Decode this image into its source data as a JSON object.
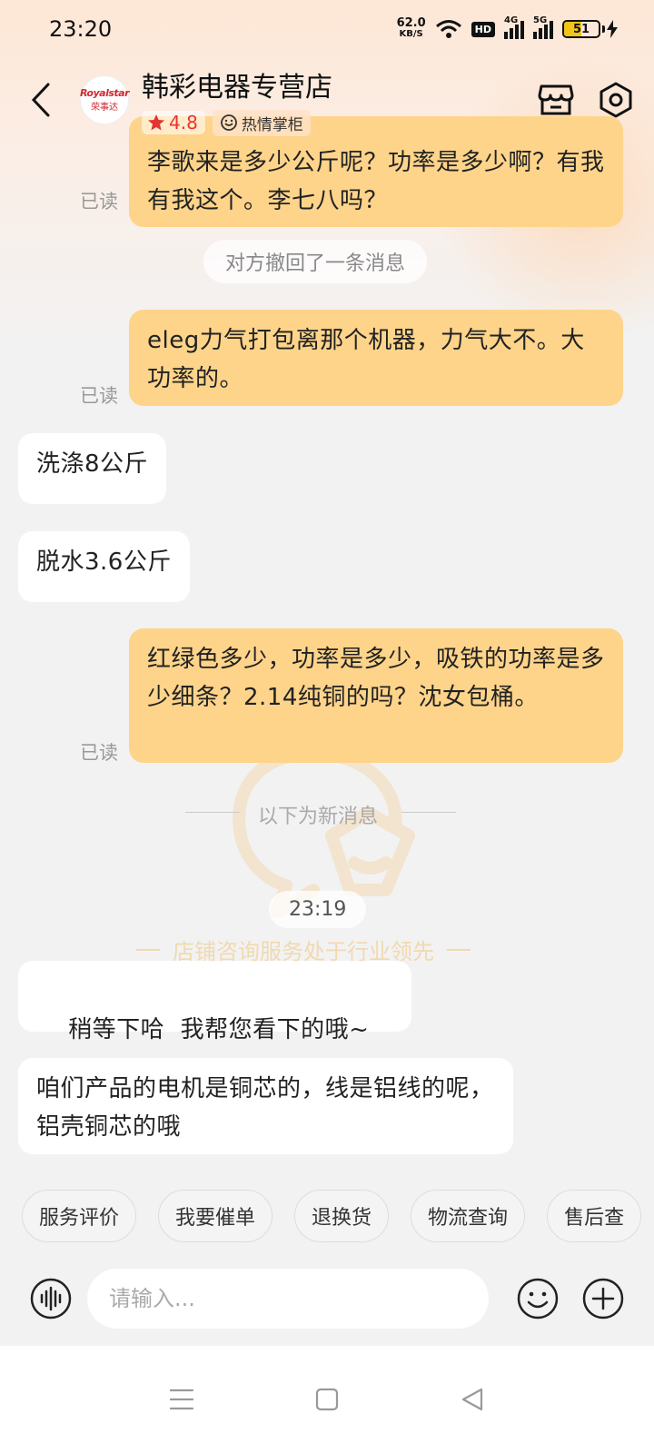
{
  "status_bar": {
    "time": "23:20",
    "net_speed_value": "62.0",
    "net_speed_unit": "KB/S",
    "hd_label": "HD",
    "signal1_label": "4G",
    "signal2_label": "5G",
    "battery_level": "51",
    "battery_fraction": 0.51,
    "battery_color": "#f0c419"
  },
  "header": {
    "back_icon": "chevron-left-icon",
    "avatar_brand": "Royalstar",
    "avatar_brand_cn": "荣事达",
    "shop_name": "韩彩电器专营店",
    "rating": "4.8",
    "badge": "热情掌柜",
    "store_icon": "store-icon",
    "settings_icon": "settings-icon"
  },
  "messages": [
    {
      "side": "me",
      "text": "李歌来是多少公斤呢？功率是多少啊？有我有我这个。李七八吗？",
      "status": "已读"
    },
    {
      "system": "对方撤回了一条消息"
    },
    {
      "side": "me",
      "text": "eleg力气打包离那个机器，力气大不。大功率的。",
      "status": "已读"
    },
    {
      "side": "them",
      "text": "洗涤8公斤"
    },
    {
      "side": "them",
      "text": "脱水3.6公斤"
    },
    {
      "side": "me",
      "text": "红绿色多少，功率是多少，吸铁的功率是多少细条？2.14纯铜的吗？沈女包桶。",
      "status": "已读"
    },
    {
      "divider": "以下为新消息"
    },
    {
      "timestamp": "23:19"
    },
    {
      "side": "them",
      "text": "稍等下哈  我帮您看下的哦~"
    },
    {
      "side": "them",
      "text": "咱们产品的电机是铜芯的，线是铝线的呢，铝壳铜芯的哦"
    }
  ],
  "watermark_slogan": "店铺咨询服务处于行业领先",
  "quick_actions": [
    "服务评价",
    "我要催单",
    "退换货",
    "物流查询",
    "售后查"
  ],
  "input": {
    "placeholder": "请输入...",
    "voice_icon": "voice-wave-icon",
    "emoji_icon": "smiley-icon",
    "plus_icon": "plus-circle-icon"
  },
  "nav": {
    "menu_icon": "menu-icon",
    "home_icon": "square-home-icon",
    "back_icon": "triangle-back-icon"
  },
  "colors": {
    "my_bubble": "#fdd48a",
    "their_bubble": "#ffffff",
    "rating_star": "#e33333"
  }
}
